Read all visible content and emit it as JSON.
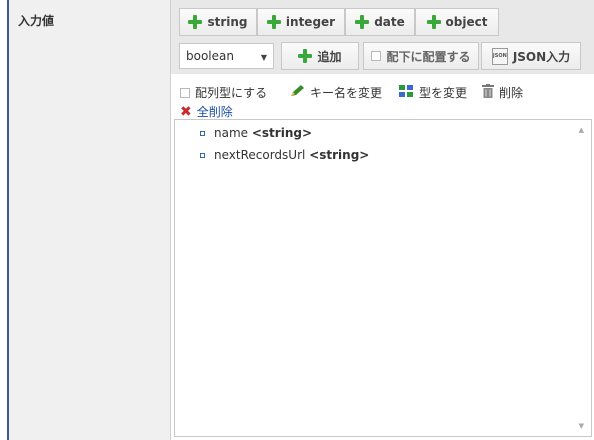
{
  "field": {
    "label": "入力値"
  },
  "type_buttons": [
    "string",
    "integer",
    "date",
    "object"
  ],
  "type_select": {
    "selected": "boolean"
  },
  "add_button": {
    "label": "追加"
  },
  "place_under": {
    "label": "配下に配置する",
    "checked": false
  },
  "json_input_button": {
    "label": "JSON入力",
    "icon_text": "JSON"
  },
  "actions": {
    "array_toggle": {
      "label": "配列型にする",
      "checked": false
    },
    "rename_key": "キー名を変更",
    "change_type": "型を変更",
    "delete": "削除",
    "delete_all": "全削除"
  },
  "tree": {
    "nodes": [
      {
        "name": "name",
        "type": "<string>"
      },
      {
        "name": "nextRecordsUrl",
        "type": "<string>"
      }
    ]
  },
  "colors": {
    "accent_green": "#3aa83a",
    "delete_red": "#cc2a2a",
    "frame_blue": "#3c5a8c"
  }
}
